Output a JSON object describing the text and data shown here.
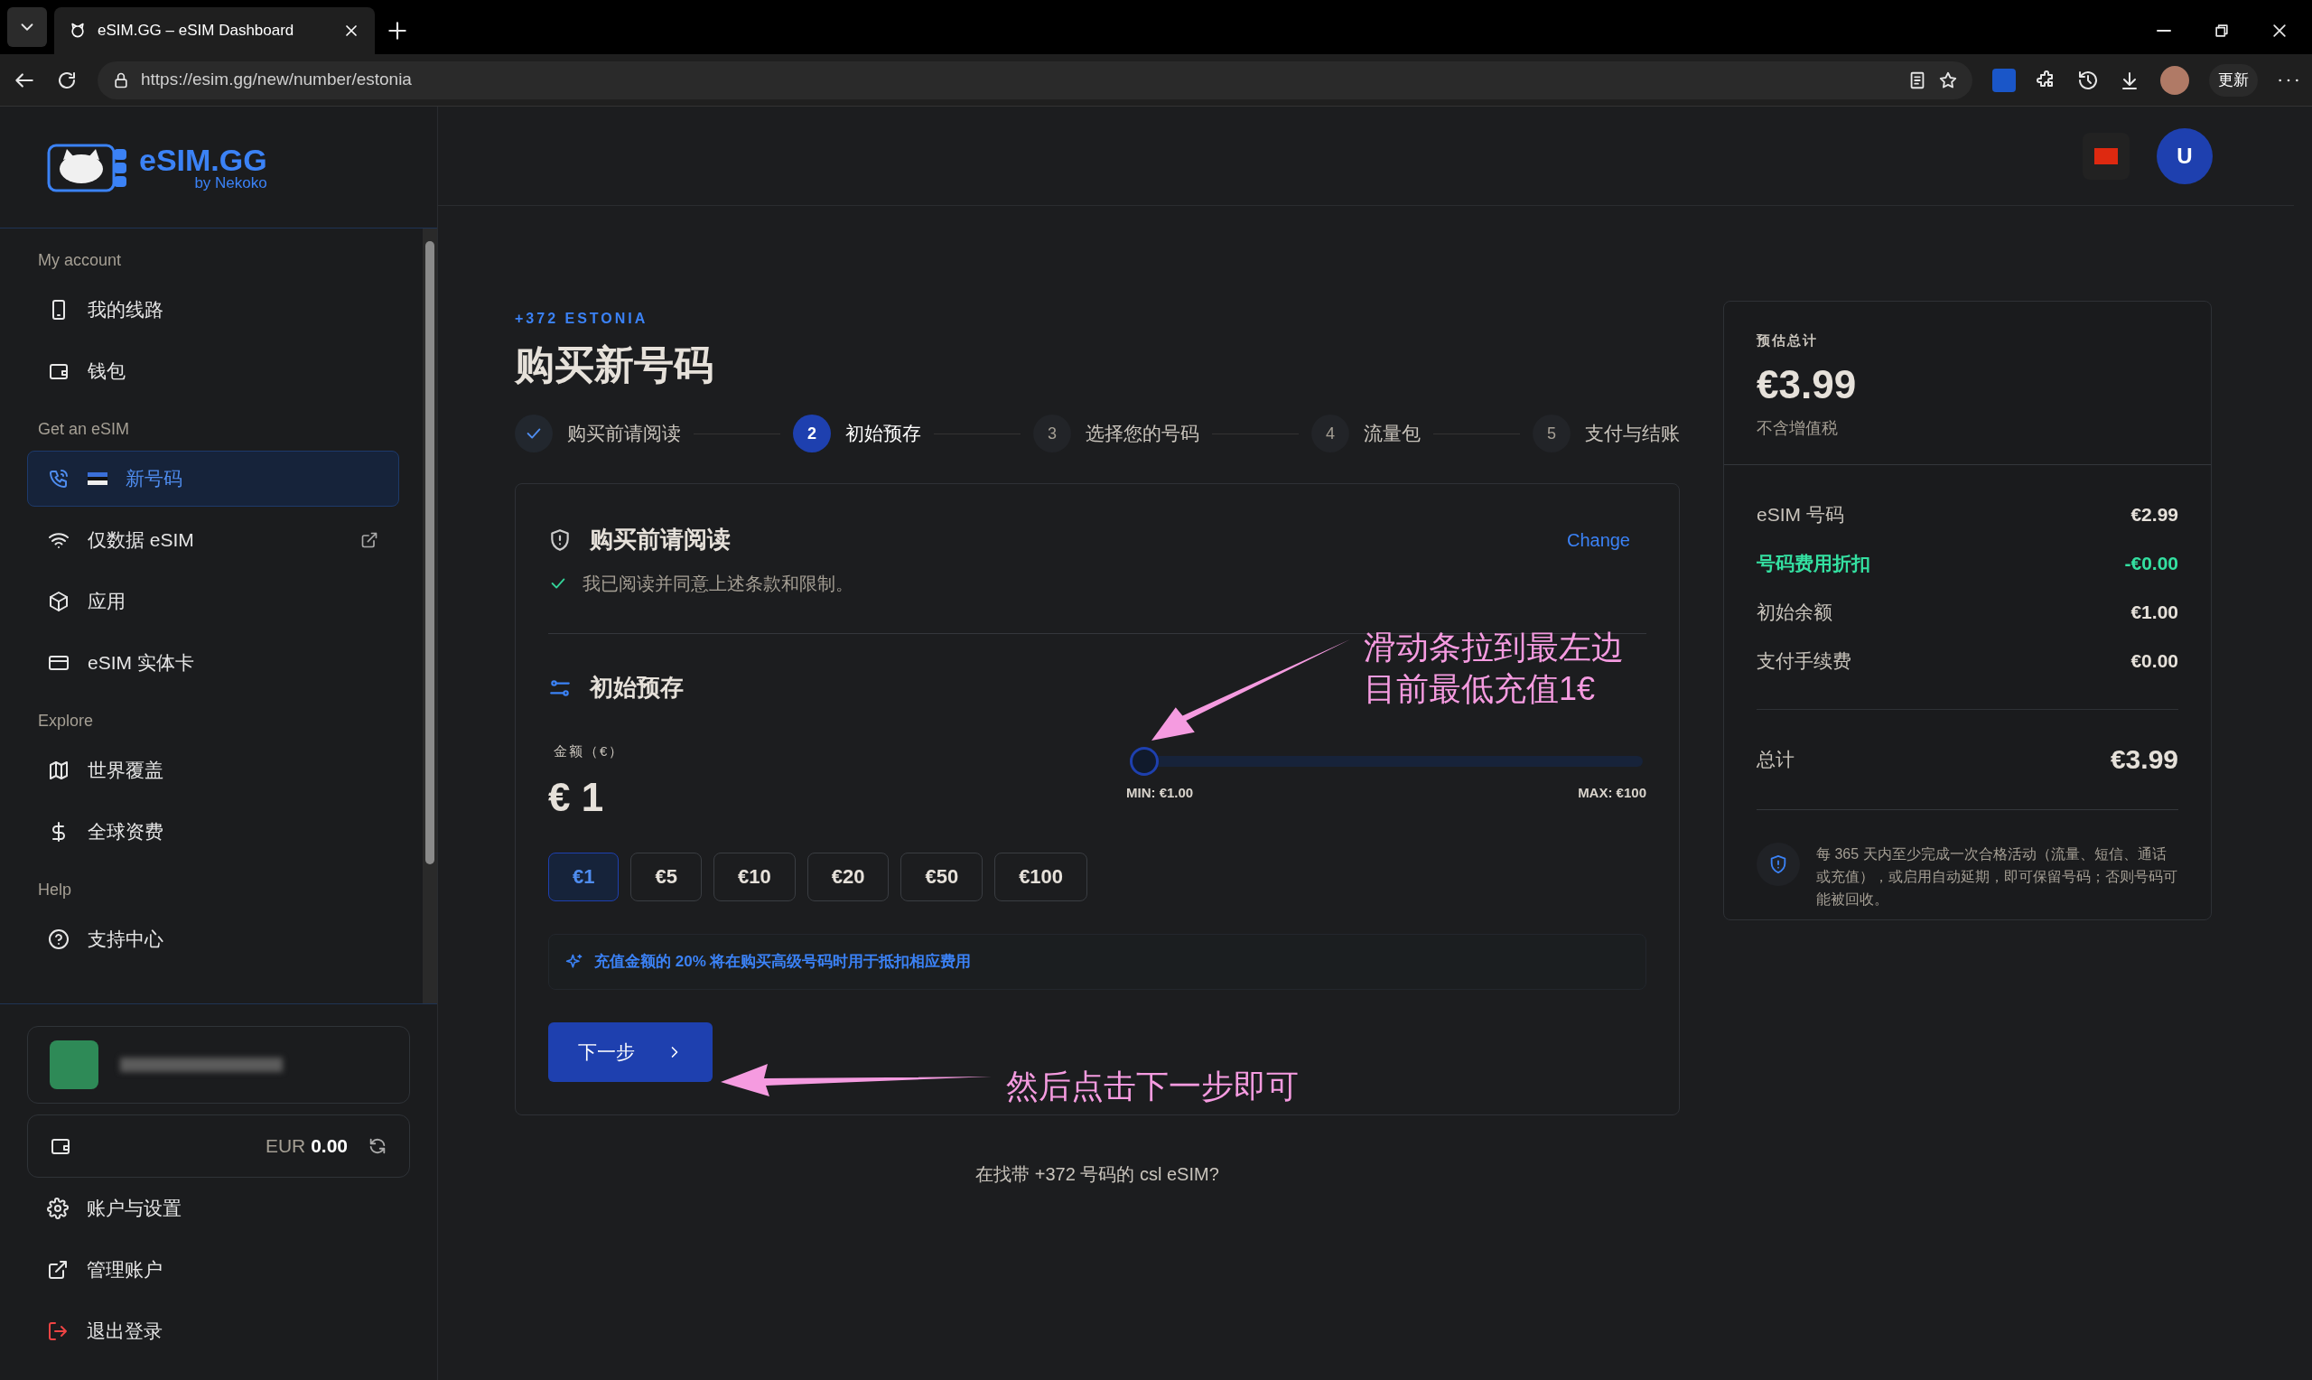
{
  "browser": {
    "tab_title": "eSIM.GG – eSIM Dashboard",
    "url": "https://esim.gg/new/number/estonia",
    "update_button": "更新"
  },
  "sidebar": {
    "logo": {
      "name": "eSIM.GG",
      "sub": "by Nekoko"
    },
    "sections": [
      {
        "title": "My account",
        "items": [
          {
            "label": "我的线路",
            "selected": false,
            "external": false
          },
          {
            "label": "钱包",
            "selected": false,
            "external": false
          }
        ]
      },
      {
        "title": "Get an eSIM",
        "items": [
          {
            "label": "新号码",
            "selected": true,
            "external": false
          },
          {
            "label": "仅数据 eSIM",
            "selected": false,
            "external": true
          },
          {
            "label": "应用",
            "selected": false,
            "external": false
          },
          {
            "label": "eSIM 实体卡",
            "selected": false,
            "external": false
          }
        ]
      },
      {
        "title": "Explore",
        "items": [
          {
            "label": "世界覆盖",
            "selected": false,
            "external": false
          },
          {
            "label": "全球资费",
            "selected": false,
            "external": false
          }
        ]
      },
      {
        "title": "Help",
        "items": [
          {
            "label": "支持中心",
            "selected": false,
            "external": false
          }
        ]
      }
    ],
    "balance": {
      "currency": "EUR",
      "amount": "0.00"
    },
    "footer_items": [
      {
        "label": "账户与设置",
        "kind": "normal"
      },
      {
        "label": "管理账户",
        "kind": "normal"
      },
      {
        "label": "退出登录",
        "kind": "danger"
      }
    ]
  },
  "header": {
    "avatar": "U"
  },
  "main": {
    "country": "+372 ESTONIA",
    "title": "购买新号码",
    "steps": [
      {
        "label": "购买前请阅读",
        "completed": true,
        "selected": false
      },
      {
        "number": "2",
        "label": "初始预存",
        "completed": false,
        "selected": true
      },
      {
        "number": "3",
        "label": "选择您的号码",
        "completed": false,
        "selected": false
      },
      {
        "number": "4",
        "label": "流量包",
        "completed": false,
        "selected": false
      },
      {
        "number": "5",
        "label": "支付与结账",
        "completed": false,
        "selected": false
      }
    ],
    "terms": {
      "title": "购买前请阅读",
      "change": "Change",
      "agreed": "我已阅读并同意上述条款和限制。"
    },
    "deposit": {
      "title": "初始预存",
      "amount_label": "金额（€）",
      "amount": "€ 1",
      "slider": {
        "level": 0,
        "min": "MIN: €1.00",
        "max": "MAX: €100"
      },
      "presets": [
        {
          "label": "€1",
          "selected": true
        },
        {
          "label": "€5",
          "selected": false
        },
        {
          "label": "€10",
          "selected": false
        },
        {
          "label": "€20",
          "selected": false
        },
        {
          "label": "€50",
          "selected": false
        },
        {
          "label": "€100",
          "selected": false
        }
      ],
      "note": "充值金额的 20% 将在购买高级号码时用于抵扣相应费用",
      "next": "下一步"
    },
    "footer_question": "在找带 +372 号码的 csl eSIM?"
  },
  "summary": {
    "label": "预估总计",
    "estimate": "€3.99",
    "vat_note": "不含增值税",
    "lines": [
      {
        "label": "eSIM 号码",
        "value": "€2.99",
        "kind": "normal"
      },
      {
        "label": "号码费用折扣",
        "value": "-€0.00",
        "kind": "discount"
      },
      {
        "label": "初始余额",
        "value": "€1.00",
        "kind": "normal"
      },
      {
        "label": "支付手续费",
        "value": "€0.00",
        "kind": "normal"
      }
    ],
    "total_label": "总计",
    "total_value": "€3.99",
    "notice": "每 365 天内至少完成一次合格活动（流量、短信、通话或充值），或启用自动延期，即可保留号码；否则号码可能被回收。"
  },
  "annotations": [
    {
      "kind": "slider",
      "lines": [
        "滑动条拉到最左边",
        "目前最低充值1€"
      ]
    },
    {
      "kind": "button",
      "lines": [
        "然后点击下一步即可"
      ]
    }
  ]
}
